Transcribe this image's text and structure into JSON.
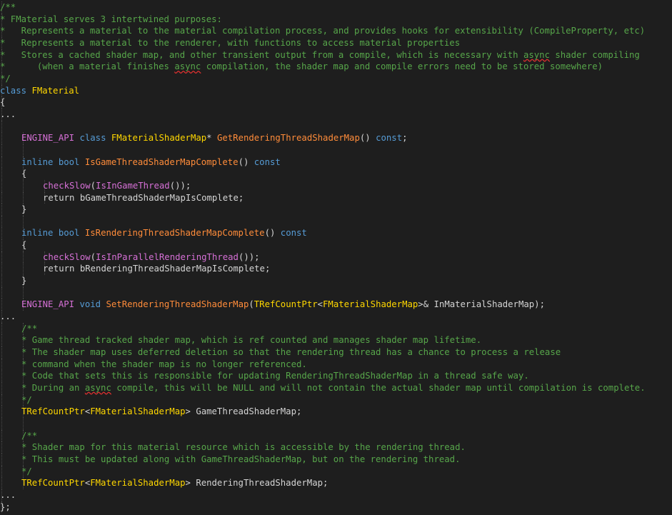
{
  "editor": {
    "theme": {
      "background": "#1e1e1e",
      "comment": "#57a64a",
      "keyword": "#569cd6",
      "type": "#ffd700",
      "function": "#ff8c3a",
      "macro": "#d670d6",
      "text": "#d4d4d4",
      "squiggle": "#e0302f"
    },
    "lines": [
      {
        "indent": 0,
        "tokens": [
          [
            "/**",
            "comment"
          ]
        ]
      },
      {
        "indent": 0,
        "tokens": [
          [
            "* FMaterial serves 3 intertwined purposes:",
            "comment"
          ]
        ]
      },
      {
        "indent": 0,
        "tokens": [
          [
            "*   Represents a material to the material compilation process, and provides hooks for extensibility (CompileProperty, etc)",
            "comment"
          ]
        ]
      },
      {
        "indent": 0,
        "tokens": [
          [
            "*   Represents a material to the renderer, with functions to access material properties",
            "comment"
          ]
        ]
      },
      {
        "indent": 0,
        "tokens": [
          [
            "*   Stores a cached shader map, and other transient output from a compile, which is necessary with ",
            "comment"
          ],
          [
            "async",
            "comment-squiggle"
          ],
          [
            " shader compiling",
            "comment"
          ]
        ]
      },
      {
        "indent": 0,
        "tokens": [
          [
            "*      (when a material finishes ",
            "comment"
          ],
          [
            "async",
            "comment-squiggle"
          ],
          [
            " compilation, the shader map and compile errors need to be stored somewhere)",
            "comment"
          ]
        ]
      },
      {
        "indent": 0,
        "tokens": [
          [
            "*/",
            "comment"
          ]
        ]
      },
      {
        "indent": 0,
        "tokens": [
          [
            "class",
            "keyword"
          ],
          [
            " ",
            "plain"
          ],
          [
            "FMaterial",
            "type"
          ]
        ]
      },
      {
        "indent": 0,
        "tokens": [
          [
            "{",
            "plain"
          ]
        ]
      },
      {
        "indent": 0,
        "tokens": [
          [
            "...",
            "plain"
          ]
        ]
      },
      {
        "indent": 0,
        "tokens": []
      },
      {
        "indent": 1,
        "tokens": [
          [
            "ENGINE_API",
            "magenta"
          ],
          [
            " ",
            "plain"
          ],
          [
            "class",
            "keyword"
          ],
          [
            " ",
            "plain"
          ],
          [
            "FMaterialShaderMap",
            "type"
          ],
          [
            "* ",
            "plain"
          ],
          [
            "GetRenderingThreadShaderMap",
            "func"
          ],
          [
            "() ",
            "plain"
          ],
          [
            "const",
            "keyword"
          ],
          [
            ";",
            "plain"
          ]
        ]
      },
      {
        "indent": 1,
        "tokens": []
      },
      {
        "indent": 1,
        "tokens": [
          [
            "inline",
            "keyword"
          ],
          [
            " ",
            "plain"
          ],
          [
            "bool",
            "keyword"
          ],
          [
            " ",
            "plain"
          ],
          [
            "IsGameThreadShaderMapComplete",
            "func"
          ],
          [
            "() ",
            "plain"
          ],
          [
            "const",
            "keyword"
          ]
        ]
      },
      {
        "indent": 1,
        "tokens": [
          [
            "{",
            "plain"
          ]
        ]
      },
      {
        "indent": 2,
        "tokens": [
          [
            "checkSlow",
            "magenta"
          ],
          [
            "(",
            "plain"
          ],
          [
            "IsInGameThread",
            "magenta"
          ],
          [
            "());",
            "plain"
          ]
        ]
      },
      {
        "indent": 2,
        "tokens": [
          [
            "return",
            "plain"
          ],
          [
            " bGameThreadShaderMapIsComplete;",
            "plain"
          ]
        ]
      },
      {
        "indent": 1,
        "tokens": [
          [
            "}",
            "plain"
          ]
        ]
      },
      {
        "indent": 1,
        "tokens": []
      },
      {
        "indent": 1,
        "tokens": [
          [
            "inline",
            "keyword"
          ],
          [
            " ",
            "plain"
          ],
          [
            "bool",
            "keyword"
          ],
          [
            " ",
            "plain"
          ],
          [
            "IsRenderingThreadShaderMapComplete",
            "func"
          ],
          [
            "() ",
            "plain"
          ],
          [
            "const",
            "keyword"
          ]
        ]
      },
      {
        "indent": 1,
        "tokens": [
          [
            "{",
            "plain"
          ]
        ]
      },
      {
        "indent": 2,
        "tokens": [
          [
            "checkSlow",
            "magenta"
          ],
          [
            "(",
            "plain"
          ],
          [
            "IsInParallelRenderingThread",
            "magenta"
          ],
          [
            "());",
            "plain"
          ]
        ]
      },
      {
        "indent": 2,
        "tokens": [
          [
            "return",
            "plain"
          ],
          [
            " bRenderingThreadShaderMapIsComplete;",
            "plain"
          ]
        ]
      },
      {
        "indent": 1,
        "tokens": [
          [
            "}",
            "plain"
          ]
        ]
      },
      {
        "indent": 1,
        "tokens": []
      },
      {
        "indent": 1,
        "tokens": [
          [
            "ENGINE_API",
            "magenta"
          ],
          [
            " ",
            "plain"
          ],
          [
            "void",
            "keyword"
          ],
          [
            " ",
            "plain"
          ],
          [
            "SetRenderingThreadShaderMap",
            "func"
          ],
          [
            "(",
            "plain"
          ],
          [
            "TRefCountPtr",
            "type"
          ],
          [
            "<",
            "plain"
          ],
          [
            "FMaterialShaderMap",
            "type"
          ],
          [
            ">& InMaterialShaderMap);",
            "plain"
          ]
        ]
      },
      {
        "indent": 0,
        "tokens": [
          [
            "...",
            "plain"
          ]
        ]
      },
      {
        "indent": 1,
        "tokens": [
          [
            "/**",
            "comment"
          ]
        ]
      },
      {
        "indent": 1,
        "tokens": [
          [
            "* Game thread tracked shader map, which is ref counted and manages shader map lifetime.",
            "comment"
          ]
        ]
      },
      {
        "indent": 1,
        "tokens": [
          [
            "* The shader map uses deferred deletion so that the rendering thread has a chance to process a release",
            "comment"
          ]
        ]
      },
      {
        "indent": 1,
        "tokens": [
          [
            "* command when the shader map is no longer referenced.",
            "comment"
          ]
        ]
      },
      {
        "indent": 1,
        "tokens": [
          [
            "* Code that sets this is responsible for updating RenderingThreadShaderMap in a thread safe way.",
            "comment"
          ]
        ]
      },
      {
        "indent": 1,
        "tokens": [
          [
            "* During an ",
            "comment"
          ],
          [
            "async",
            "comment-squiggle"
          ],
          [
            " compile, this will be NULL and will not contain the actual shader map until compilation is complete.",
            "comment"
          ]
        ]
      },
      {
        "indent": 1,
        "tokens": [
          [
            "*/",
            "comment"
          ]
        ]
      },
      {
        "indent": 1,
        "tokens": [
          [
            "TRefCountPtr",
            "type"
          ],
          [
            "<",
            "plain"
          ],
          [
            "FMaterialShaderMap",
            "type"
          ],
          [
            "> GameThreadShaderMap;",
            "plain"
          ]
        ]
      },
      {
        "indent": 1,
        "tokens": []
      },
      {
        "indent": 1,
        "tokens": [
          [
            "/**",
            "comment"
          ]
        ]
      },
      {
        "indent": 1,
        "tokens": [
          [
            "* Shader map for this material resource which is accessible by the rendering thread.",
            "comment"
          ]
        ]
      },
      {
        "indent": 1,
        "tokens": [
          [
            "* This must be updated along with GameThreadShaderMap, but on the rendering thread.",
            "comment"
          ]
        ]
      },
      {
        "indent": 1,
        "tokens": [
          [
            "*/",
            "comment"
          ]
        ]
      },
      {
        "indent": 1,
        "tokens": [
          [
            "TRefCountPtr",
            "type"
          ],
          [
            "<",
            "plain"
          ],
          [
            "FMaterialShaderMap",
            "type"
          ],
          [
            "> RenderingThreadShaderMap;",
            "plain"
          ]
        ]
      },
      {
        "indent": 0,
        "tokens": [
          [
            "...",
            "plain"
          ]
        ]
      },
      {
        "indent": 0,
        "tokens": [
          [
            "};",
            "plain"
          ]
        ]
      }
    ]
  }
}
